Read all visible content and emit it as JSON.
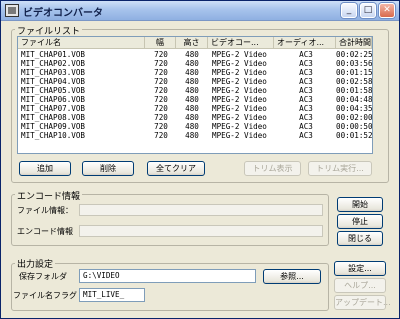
{
  "window": {
    "title": "ビデオコンバータ"
  },
  "title_buttons": {
    "minimize": "_",
    "maximize": "□",
    "close": "✕"
  },
  "file_list": {
    "group_label": "ファイルリスト",
    "columns": [
      "ファイル名",
      "幅",
      "高さ",
      "ビデオコー...",
      "オーディオ...",
      "合計時間"
    ],
    "rows": [
      {
        "name": "MIT_CHAP01.VOB",
        "width": "720",
        "height": "480",
        "video": "MPEG-2 Video",
        "audio": "AC3",
        "time": "00:02:25"
      },
      {
        "name": "MIT_CHAP02.VOB",
        "width": "720",
        "height": "480",
        "video": "MPEG-2 Video",
        "audio": "AC3",
        "time": "00:03:56"
      },
      {
        "name": "MIT_CHAP03.VOB",
        "width": "720",
        "height": "480",
        "video": "MPEG-2 Video",
        "audio": "AC3",
        "time": "00:01:15"
      },
      {
        "name": "MIT_CHAP04.VOB",
        "width": "720",
        "height": "480",
        "video": "MPEG-2 Video",
        "audio": "AC3",
        "time": "00:02:58"
      },
      {
        "name": "MIT_CHAP05.VOB",
        "width": "720",
        "height": "480",
        "video": "MPEG-2 Video",
        "audio": "AC3",
        "time": "00:01:58"
      },
      {
        "name": "MIT_CHAP06.VOB",
        "width": "720",
        "height": "480",
        "video": "MPEG-2 Video",
        "audio": "AC3",
        "time": "00:04:48"
      },
      {
        "name": "MIT_CHAP07.VOB",
        "width": "720",
        "height": "480",
        "video": "MPEG-2 Video",
        "audio": "AC3",
        "time": "00:04:35"
      },
      {
        "name": "MIT_CHAP08.VOB",
        "width": "720",
        "height": "480",
        "video": "MPEG-2 Video",
        "audio": "AC3",
        "time": "00:02:00"
      },
      {
        "name": "MIT_CHAP09.VOB",
        "width": "720",
        "height": "480",
        "video": "MPEG-2 Video",
        "audio": "AC3",
        "time": "00:00:50"
      },
      {
        "name": "MIT_CHAP10.VOB",
        "width": "720",
        "height": "480",
        "video": "MPEG-2 Video",
        "audio": "AC3",
        "time": "00:01:52"
      }
    ],
    "buttons": {
      "add": "追加",
      "remove": "削除",
      "clear_all": "全てクリア",
      "show_trim": "トリム表示",
      "run_trim": "トリム実行..."
    }
  },
  "encode_info": {
    "group_label": "エンコード情報",
    "file_info_label": "ファイル情報：",
    "encode_info_label": "エンコード情報"
  },
  "side_buttons": {
    "start": "開始",
    "stop": "停止",
    "close": "閉じる",
    "settings": "設定...",
    "help": "ヘルプ...",
    "update": "アップデート..."
  },
  "output": {
    "group_label": "出力設定",
    "folder_label": "保存フォルダ",
    "folder_value": "G:\\VIDEO",
    "browse_button": "参照...",
    "name_flag_label": "ファイル名フラグ",
    "name_flag_value": "MIT_LIVE_"
  }
}
